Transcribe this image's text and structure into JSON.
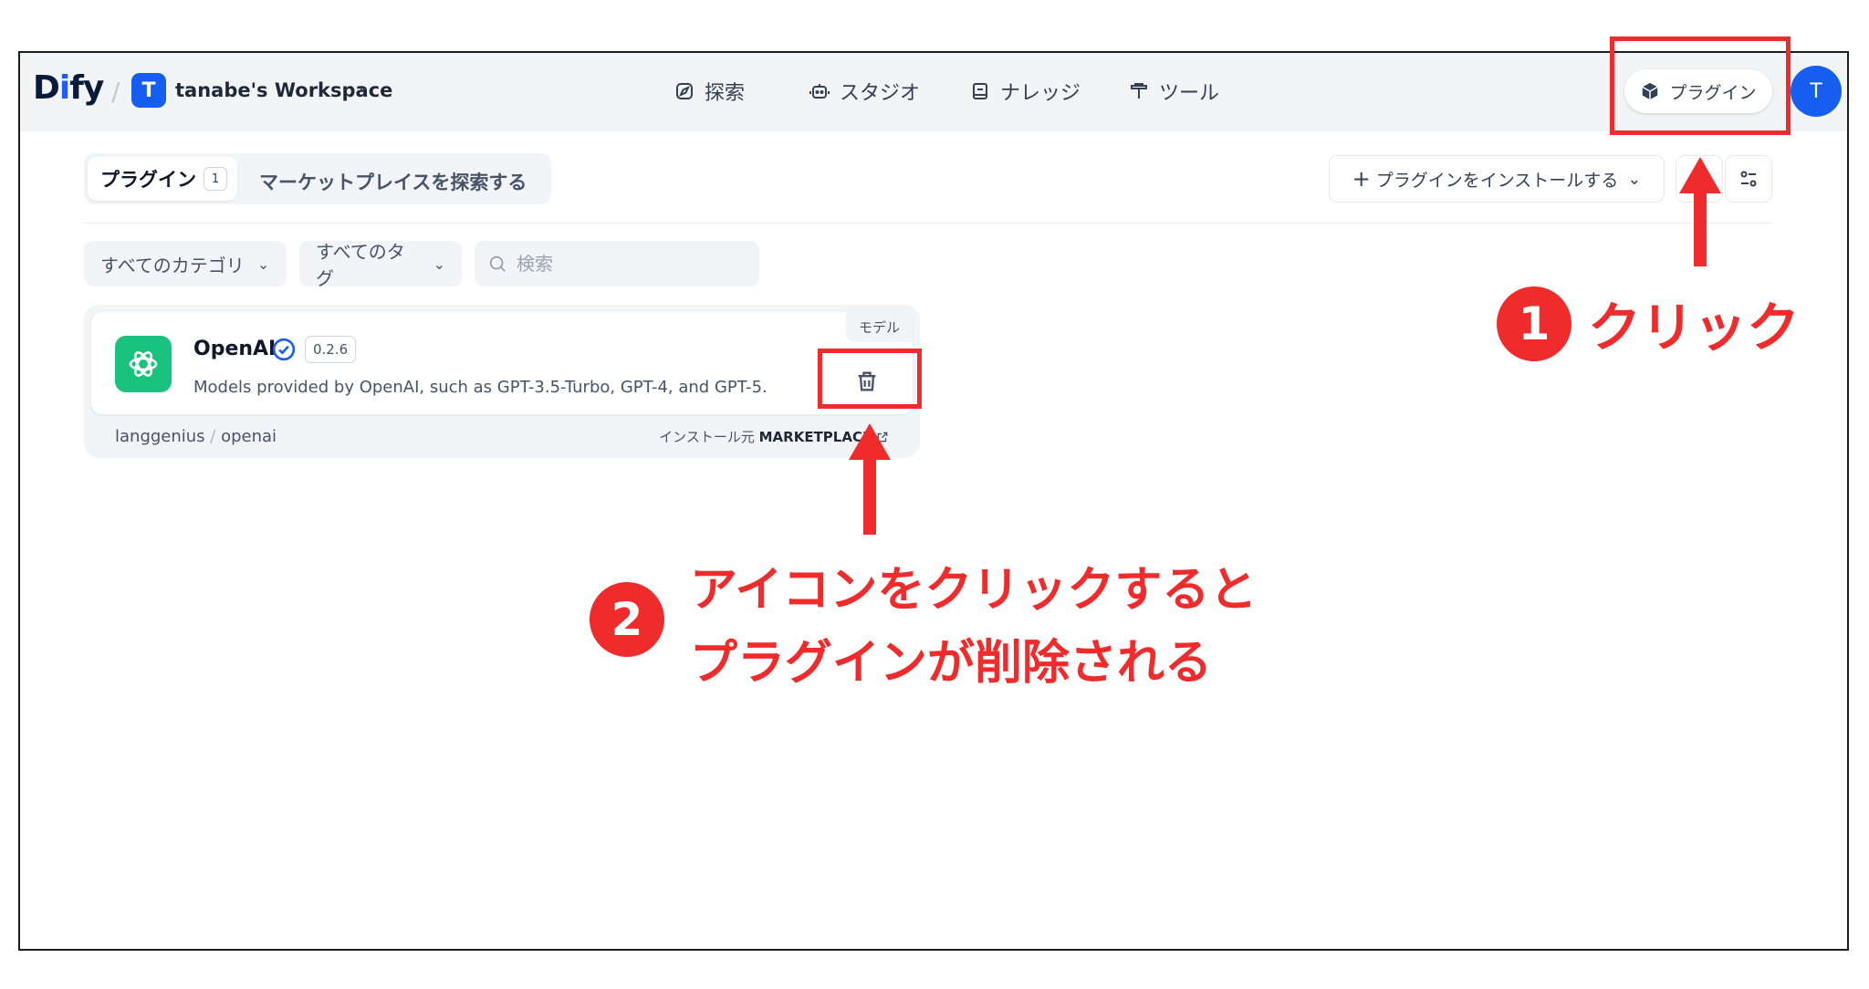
{
  "header": {
    "logo": "Dify",
    "workspace_initial": "T",
    "workspace_name": "tanabe's Workspace",
    "nav": [
      "探索",
      "スタジオ",
      "ナレッジ",
      "ツール"
    ],
    "plugins_button": "プラグイン",
    "avatar_initial": "T"
  },
  "tabs": {
    "plugins_label": "プラグイン",
    "plugins_count": "1",
    "marketplace_label": "マーケットプレイスを探索する"
  },
  "toolbar": {
    "install_label": "プラグインをインストールする"
  },
  "filters": {
    "category": "すべてのカテゴリ",
    "tags": "すべてのタグ",
    "search_placeholder": "検索"
  },
  "plugin_card": {
    "name": "OpenAI",
    "version": "0.2.6",
    "category_tag": "モデル",
    "description": "Models provided by OpenAI, such as GPT-3.5-Turbo, GPT-4, and GPT-5.",
    "org": "langgenius",
    "slug": "openai",
    "installed_from_label": "インストール元",
    "installed_from_value": "MARKETPLACE"
  },
  "annotations": {
    "step1_number": "1",
    "step1_text": "クリック",
    "step2_number": "2",
    "step2_line1": "アイコンをクリックすると",
    "step2_line2": "プラグインが削除される",
    "highlight_color": "#ef2b2b"
  },
  "colors": {
    "brand": "#155eef",
    "openai_green": "#19c37d"
  }
}
